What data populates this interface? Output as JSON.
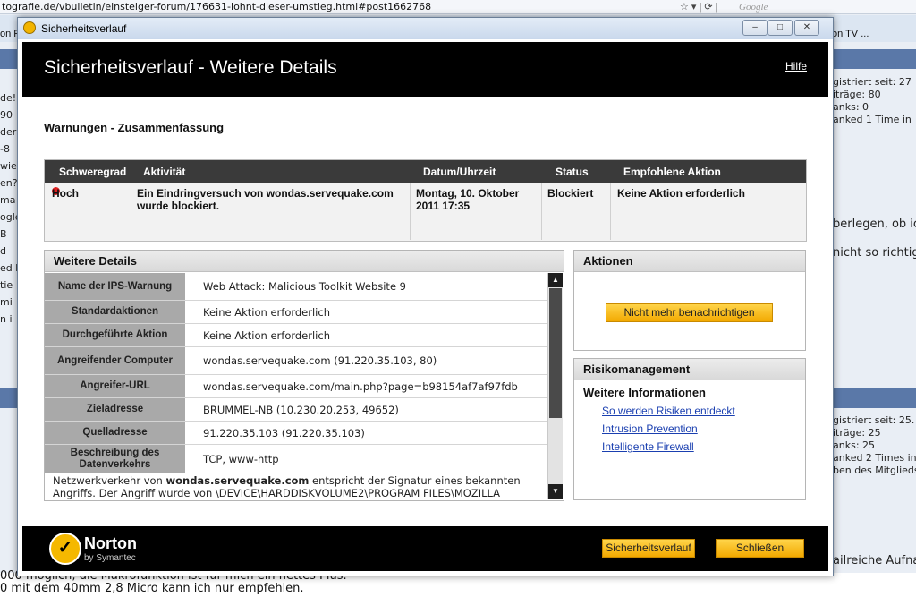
{
  "browser": {
    "url": "tografie.de/vbulletin/einsteiger-forum/176631-lohnt-dieser-umstieg.html#post1662768",
    "search_placeholder": "Google",
    "tab_left": "on F",
    "tab_right": "on TV ..."
  },
  "background": {
    "right_lines_1": [
      "gistriert seit: 27",
      "iträge: 80",
      "anks: 0",
      "anked 1 Time in"
    ],
    "right_lines_2": [
      "berlegen, ob ic",
      "nicht so richtig"
    ],
    "right_lines_3": [
      "gistriert seit: 25.",
      "iträge: 25",
      "anks: 25",
      "anked 2 Times in",
      "ben des Mitglieds"
    ],
    "right_bottom": "ailreiche Aufna",
    "left_lines": [
      "de!",
      "90",
      "der",
      "-8",
      "wie",
      "en?",
      "ma",
      "ogle",
      "B",
      "d",
      "ed h",
      "tie",
      "mi",
      "n i"
    ],
    "bottom_line_1": "000 möglich, die Makrofunktion ist für mich ein nettes Plus.",
    "bottom_line_2": "0 mit dem 40mm 2,8 Micro kann ich nur empfehlen."
  },
  "window": {
    "title": "Sicherheitsverlauf",
    "minimize": "–",
    "maximize": "□",
    "close": "✕"
  },
  "header": {
    "title": "Sicherheitsverlauf - Weitere Details",
    "help": "Hilfe"
  },
  "summary": {
    "title": "Warnungen - Zusammenfassung",
    "columns": [
      "Schweregrad",
      "Aktivität",
      "Datum/Uhrzeit",
      "Status",
      "Empfohlene Aktion"
    ],
    "row": {
      "severity": "Hoch",
      "activity": "Ein Eindringversuch von wondas.servequake.com wurde blockiert.",
      "datetime": "Montag, 10. Oktober 2011 17:35",
      "status": "Blockiert",
      "action": "Keine Aktion erforderlich"
    }
  },
  "details": {
    "title": "Weitere Details",
    "rows": [
      {
        "label": "Name der IPS-Warnung",
        "value": "Web Attack: Malicious Toolkit Website 9"
      },
      {
        "label": "Standardaktionen",
        "value": "Keine Aktion erforderlich"
      },
      {
        "label": "Durchgeführte Aktion",
        "value": "Keine Aktion erforderlich"
      },
      {
        "label": "Angreifender Computer",
        "value": "wondas.servequake.com (91.220.35.103, 80)"
      },
      {
        "label": "Angreifer-URL",
        "value": "wondas.servequake.com/main.php?page=b98154af7af97fdb"
      },
      {
        "label": "Zieladresse",
        "value": "BRUMMEL-NB (10.230.20.253, 49652)"
      },
      {
        "label": "Quelladresse",
        "value": "91.220.35.103 (91.220.35.103)"
      },
      {
        "label": "Beschreibung des Datenverkehrs",
        "value": "TCP, www-http"
      }
    ],
    "description_prefix": "Netzwerkverkehr von ",
    "description_host": "wondas.servequake.com",
    "description_suffix": " entspricht der Signatur eines bekannten Angriffs. Der Angriff wurde von \\DEVICE\\HARDDISKVOLUME2\\PROGRAM FILES\\MOZILLA FIREFOX\\"
  },
  "actions": {
    "title": "Aktionen",
    "button": "Nicht mehr benachrichtigen"
  },
  "risk": {
    "title": "Risikomanagement",
    "subtitle": "Weitere Informationen",
    "links": [
      "So werden Risiken entdeckt",
      "Intrusion Prevention",
      "Intelligente Firewall"
    ]
  },
  "footer": {
    "brand": "Norton",
    "sub": "by Symantec",
    "history_button": "Sicherheitsverlauf",
    "close_button": "Schließen"
  },
  "colors": {
    "accent": "#f2a900",
    "header_bg": "#000000",
    "link": "#1a3fb0",
    "severity_high": "#e02020"
  }
}
